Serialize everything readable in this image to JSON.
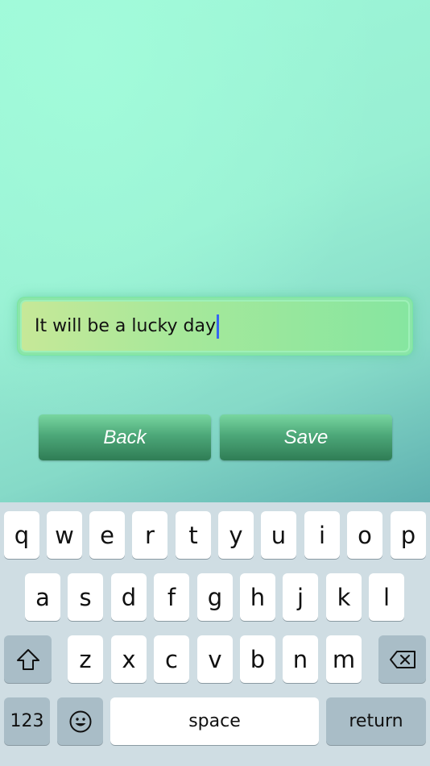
{
  "text_field": {
    "value": "It will be a lucky day"
  },
  "buttons": {
    "back": "Back",
    "save": "Save"
  },
  "keyboard": {
    "row1": [
      "q",
      "w",
      "e",
      "r",
      "t",
      "y",
      "u",
      "i",
      "o",
      "p"
    ],
    "row2": [
      "a",
      "s",
      "d",
      "f",
      "g",
      "h",
      "j",
      "k",
      "l"
    ],
    "row3": [
      "z",
      "x",
      "c",
      "v",
      "b",
      "n",
      "m"
    ],
    "numbers_key": "123",
    "space_key": "space",
    "return_key": "return",
    "icons": {
      "shift": "shift-icon",
      "delete": "backspace-icon",
      "emoji": "emoji-icon"
    }
  }
}
